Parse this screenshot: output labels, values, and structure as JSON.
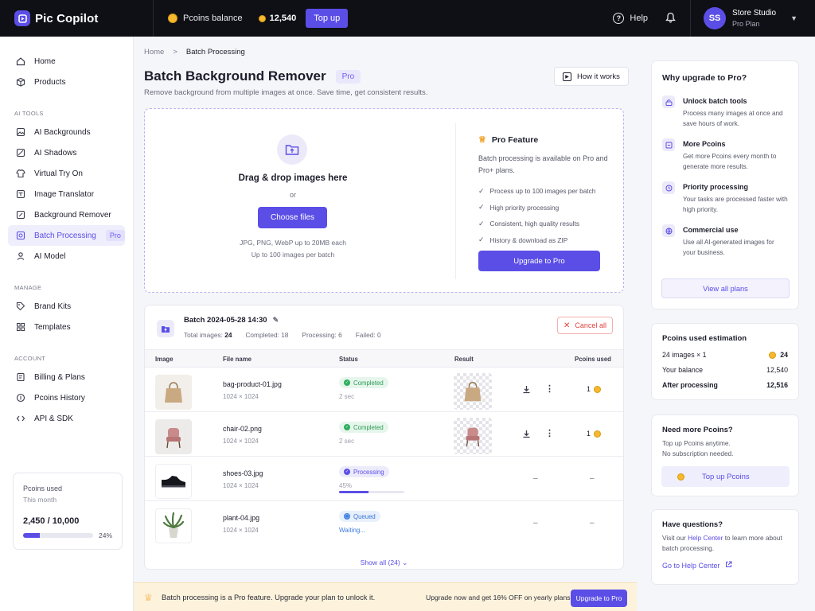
{
  "topbar": {
    "app_name": "Pic Copilot",
    "balance_label": "Pcoins balance",
    "balance_value": "12,540",
    "topup_label": "Top up",
    "help_label": "Help",
    "user_initials": "SS",
    "user_name": "Store Studio",
    "user_plan": "Pro Plan"
  },
  "sidebar": {
    "items": [
      {
        "label": "Home",
        "icon": "home-icon"
      },
      {
        "label": "Products",
        "icon": "box-icon"
      }
    ],
    "section_ai": "AI TOOLS",
    "ai_items": [
      {
        "label": "AI Backgrounds",
        "icon": "image-icon"
      },
      {
        "label": "AI Shadows",
        "icon": "shadow-icon"
      },
      {
        "label": "Virtual Try On",
        "icon": "shirt-icon"
      },
      {
        "label": "Image Translator",
        "icon": "translate-icon"
      },
      {
        "label": "Background Remover",
        "icon": "eraser-icon"
      },
      {
        "label": "Batch Processing",
        "icon": "batch-icon",
        "badge": "Pro",
        "active": true
      },
      {
        "label": "AI Model",
        "icon": "person-icon"
      }
    ],
    "section_manage": "MANAGE",
    "manage_items": [
      {
        "label": "Brand Kits",
        "icon": "tag-icon"
      },
      {
        "label": "Templates",
        "icon": "grid-icon"
      }
    ],
    "section_account": "ACCOUNT",
    "account_items": [
      {
        "label": "Billing & Plans",
        "icon": "billing-icon"
      },
      {
        "label": "Pcoins History",
        "icon": "coin-history-icon"
      },
      {
        "label": "API & SDK",
        "icon": "code-icon"
      }
    ],
    "usage": {
      "title": "Pcoins used",
      "period": "This month",
      "value": "2,450 / 10,000",
      "percent_label": "24%",
      "fraction": 0.24
    }
  },
  "main": {
    "breadcrumb_home": "Home",
    "breadcrumb_sep": ">",
    "breadcrumb_current": "Batch Processing",
    "title": "Batch Background Remover",
    "title_badge": "Pro",
    "subtitle": "Remove background from multiple images at once. Save time, get consistent results.",
    "how_it_works": "How it works",
    "upload": {
      "title": "Drag & drop images here",
      "or": "or",
      "button": "Choose files",
      "hint1": "JPG, PNG, WebP up to 20MB each",
      "hint2": "Up to 100 images per batch"
    },
    "pro_feature": {
      "title": "Pro Feature",
      "desc": "Batch processing is available on Pro and Pro+ plans.",
      "bullets": [
        "Process up to 100 images per batch",
        "High priority processing",
        "Consistent, high quality results",
        "History & download as ZIP"
      ],
      "button": "Upgrade to Pro"
    },
    "batch": {
      "name": "Batch 2024-05-28 14:30",
      "total_label": "Total images:",
      "total": "24",
      "completed_label": "Completed:",
      "completed": "18",
      "processing_label": "Processing:",
      "processing": "6",
      "failed_label": "Failed:",
      "failed": "0",
      "cancel": "Cancel all",
      "columns": [
        "Image",
        "File name",
        "Status",
        "Result",
        "Pcoins used"
      ],
      "rows": [
        {
          "file": "bag-product-01.jpg",
          "dims": "1024 × 1024",
          "status": "Completed",
          "sub": "2 sec",
          "pcoins": "1"
        },
        {
          "file": "chair-02.png",
          "dims": "1024 × 1024",
          "status": "Completed",
          "sub": "2 sec",
          "pcoins": "1"
        },
        {
          "file": "shoes-03.jpg",
          "dims": "1024 × 1024",
          "status": "Processing",
          "sub": "45%",
          "progress": 0.45,
          "pcoins": "–"
        },
        {
          "file": "plant-04.jpg",
          "dims": "1024 × 1024",
          "status": "Queued",
          "sub": "Waiting...",
          "pcoins": "–"
        }
      ],
      "dash": "–",
      "show_all": "Show all (24)"
    },
    "banner": {
      "text": "Batch processing is a Pro feature. Upgrade your plan to unlock it.",
      "offer": "Upgrade now and get 16% OFF on yearly plans!",
      "button": "Upgrade to Pro"
    }
  },
  "right": {
    "why": {
      "title": "Why upgrade to Pro?",
      "benefits": [
        {
          "title": "Unlock batch tools",
          "desc": "Process many images at once and save hours of work."
        },
        {
          "title": "More Pcoins",
          "desc": "Get more Pcoins every month to generate more results."
        },
        {
          "title": "Priority processing",
          "desc": "Your tasks are processed faster with high priority."
        },
        {
          "title": "Commercial use",
          "desc": "Use all AI-generated images for your business."
        }
      ],
      "button": "View all plans"
    },
    "estimation": {
      "title": "Pcoins used estimation",
      "row1_label": "24 images × 1",
      "row1_value": "24",
      "row2_label": "Your balance",
      "row2_value": "12,540",
      "row3_label": "After processing",
      "row3_value": "12,516"
    },
    "more": {
      "title": "Need more Pcoins?",
      "desc1": "Top up Pcoins anytime.",
      "desc2": "No subscription needed.",
      "button": "Top up Pcoins"
    },
    "questions": {
      "title": "Have questions?",
      "pre": "Visit our ",
      "link": "Help Center",
      "post": " to learn more about batch processing.",
      "cta": "Go to Help Center"
    }
  },
  "colors": {
    "accent": "#5b4ee6",
    "topbar": "#0f1016",
    "success": "#2fae5e",
    "danger": "#e0433d",
    "coin": "#f5b82e",
    "banner": "#fdf3dc"
  }
}
